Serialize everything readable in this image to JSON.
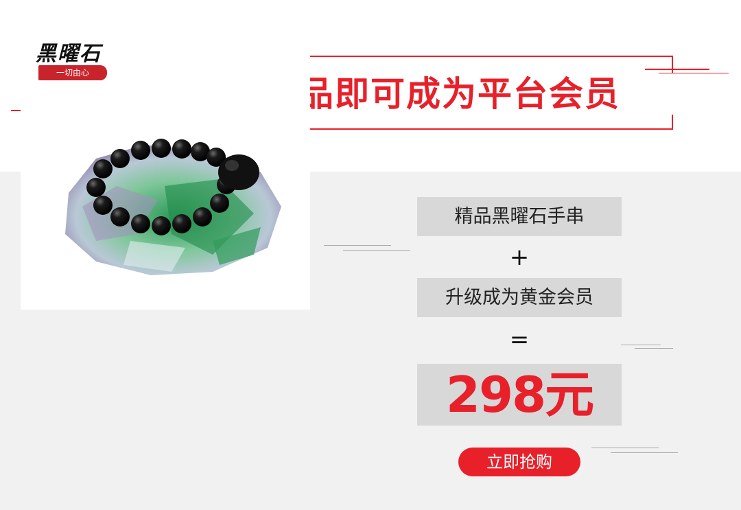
{
  "header": {
    "title": "购买以下产品即可成为平台会员",
    "accent_color": "#e8202a"
  },
  "product": {
    "brand_name": "黑曜石",
    "brand_slogan": "一切由心",
    "image_icon": "obsidian-bracelet-on-fluorite"
  },
  "offer": {
    "item_name": "精品黑曜石手串",
    "plus_sign": "+",
    "membership": "升级成为黄金会员",
    "equals_sign": "=",
    "price": "298元",
    "buy_button_label": "立即抢购"
  }
}
